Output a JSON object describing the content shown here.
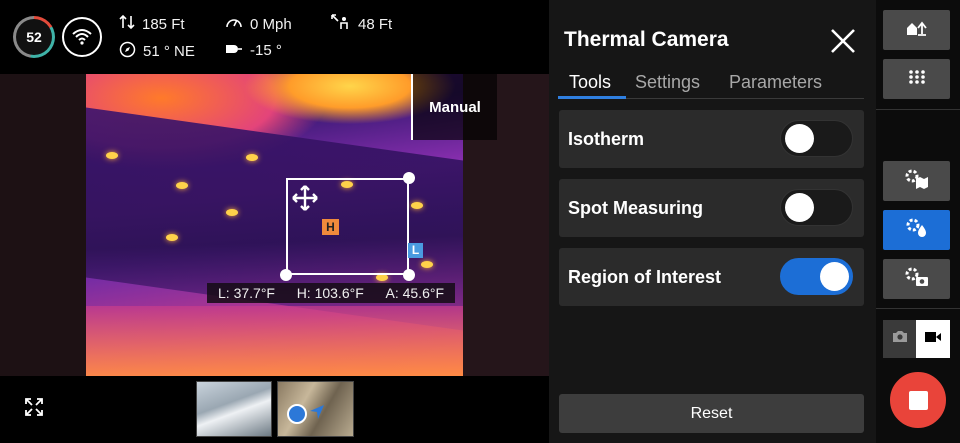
{
  "telemetry": {
    "battery_percent": "52",
    "altitude": "185 Ft",
    "heading": "51 ° NE",
    "speed": "0 Mph",
    "distance": "48 Ft",
    "gimbal_angle": "-15 °"
  },
  "camera": {
    "mode_label": "Manual",
    "readout": {
      "low": "L: 37.7°F",
      "high": "H: 103.6°F",
      "average": "A: 45.6°F"
    },
    "markers": {
      "high": "H",
      "low": "L"
    }
  },
  "panel": {
    "title": "Thermal Camera",
    "tabs": [
      {
        "label": "Tools",
        "active": true
      },
      {
        "label": "Settings",
        "active": false
      },
      {
        "label": "Parameters",
        "active": false
      }
    ],
    "options": [
      {
        "label": "Isotherm",
        "enabled": false
      },
      {
        "label": "Spot Measuring",
        "enabled": false
      },
      {
        "label": "Region of Interest",
        "enabled": true
      }
    ],
    "reset_label": "Reset"
  },
  "sidebar": {
    "buttons": [
      {
        "icon": "home-upload-icon"
      },
      {
        "icon": "grid-menu-icon"
      },
      {
        "icon": "gear-map-icon"
      },
      {
        "icon": "gear-drop-icon",
        "active": true
      },
      {
        "icon": "gear-camera-icon"
      }
    ],
    "capture_mode": "video"
  },
  "colors": {
    "accent": "#1c6ed6",
    "record": "#e9443a",
    "panel_bg": "#161616",
    "row_bg": "#2b2b2b",
    "high_marker": "#f08a3c",
    "low_marker": "#4a9be0"
  }
}
